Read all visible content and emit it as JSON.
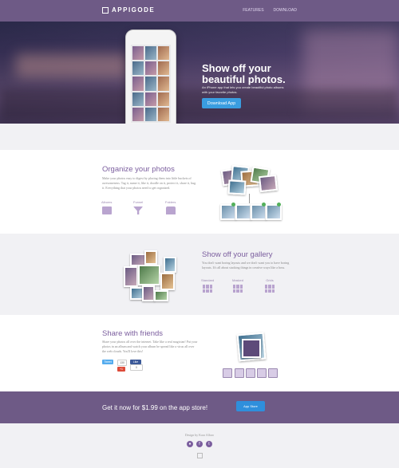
{
  "nav": {
    "logo": "APPIGODE",
    "links": [
      "FEATURES",
      "DOWNLOAD"
    ]
  },
  "hero": {
    "title": "Show off your beautiful photos.",
    "subtitle": "An iPhone app that lets you create beautiful photo albums with your favorite photos.",
    "button": "Download App"
  },
  "organize": {
    "title": "Organize your photos",
    "body": "Make your photos easy to digest by placing them into little buckets of awesomeness. Tag it, name it, like it, doodle on it, protect it, share it, hug it. Everything that your photos need to get organized.",
    "features": [
      "Albums",
      "Funnel",
      "Folders"
    ]
  },
  "gallery": {
    "title": "Show off your gallery",
    "body": "You don't want boring layouts and we don't want you to have boring layouts. It's all about stacking things in creative ways like a boss.",
    "features": [
      "Standard",
      "Masked",
      "Grids"
    ]
  },
  "share": {
    "title": "Share with friends",
    "body": "Share your photos all over the internet. Take like a real magician! Put your photos in an album and watch your album be spread like a virus all over the web clouds. You'll love this!",
    "buttons": [
      "Tweet",
      "Like",
      "+1"
    ],
    "counts": [
      "130",
      "0",
      "0"
    ]
  },
  "cta": {
    "text": "Get it now for $1.99 on the app store!",
    "store_button": "App Store"
  },
  "footer": {
    "credit": "Design by Kara Alfaro",
    "icons": [
      "dribbble-icon",
      "facebook-icon",
      "twitter-icon"
    ]
  }
}
